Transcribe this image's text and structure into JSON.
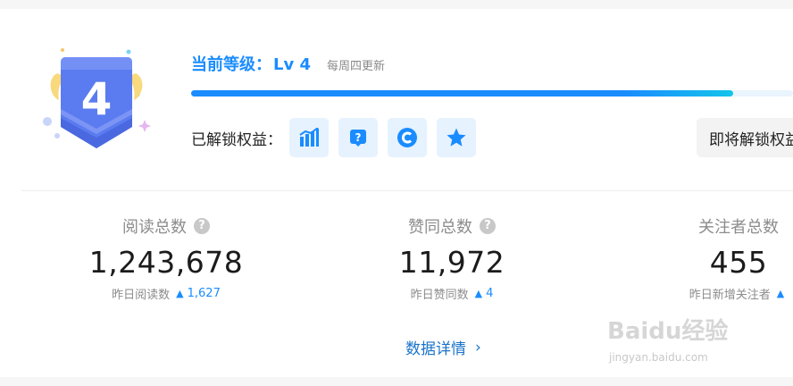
{
  "level": {
    "title": "当前等级：",
    "value": "Lv 4",
    "badge_number": "4",
    "update_note": "每周四更新",
    "progress_fraction": 0.9
  },
  "perks": {
    "label": "已解锁权益：",
    "items": [
      {
        "icon": "chart-icon"
      },
      {
        "icon": "question-icon"
      },
      {
        "icon": "copyright-icon"
      },
      {
        "icon": "star-icon"
      }
    ],
    "next_button": "即将解锁权益"
  },
  "stats": [
    {
      "label": "阅读总数",
      "value": "1,243,678",
      "sub_label": "昨日阅读数",
      "delta": "1,627"
    },
    {
      "label": "赞同总数",
      "value": "11,972",
      "sub_label": "昨日赞同数",
      "delta": "4"
    },
    {
      "label": "关注者总数",
      "value": "455",
      "sub_label": "昨日新增关注者",
      "delta": ""
    }
  ],
  "details_link": "数据详情",
  "watermark": {
    "main": "Baidu经验",
    "sub": "jingyan.baidu.com"
  },
  "colors": {
    "accent": "#1a8cff",
    "badge": "#5b7cf0",
    "perk_bg": "#e6f2fe"
  }
}
